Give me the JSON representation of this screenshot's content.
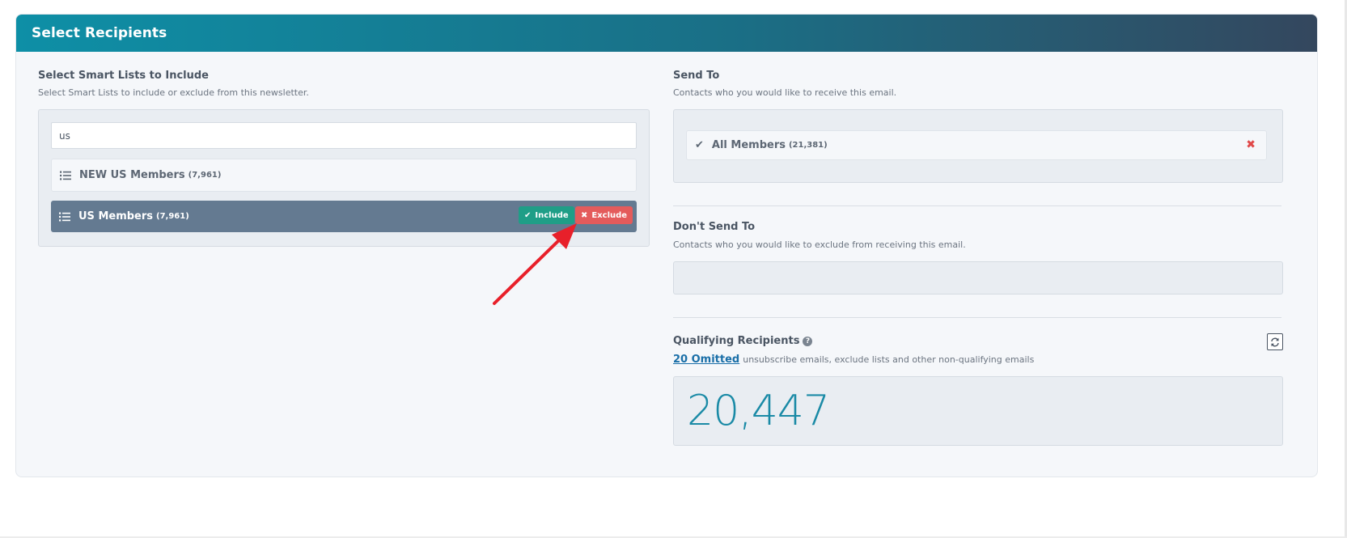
{
  "panel": {
    "title": "Select Recipients"
  },
  "include": {
    "title": "Select Smart Lists to Include",
    "subtitle": "Select Smart Lists to include or exclude from this newsletter.",
    "search_value": "us",
    "lists": [
      {
        "label": "NEW US Members",
        "count": "(7,961)"
      },
      {
        "label": "US Members",
        "count": "(7,961)"
      }
    ],
    "include_label": "Include",
    "exclude_label": "Exclude"
  },
  "send_to": {
    "title": "Send To",
    "subtitle": "Contacts who you would like to receive this email.",
    "items": [
      {
        "label": "All Members",
        "count": "(21,381)"
      }
    ]
  },
  "dont_send": {
    "title": "Don't Send To",
    "subtitle": "Contacts who you would like to exclude from receiving this email."
  },
  "qualifying": {
    "title": "Qualifying Recipients",
    "omitted_link": "20 Omitted",
    "omitted_text": "unsubscribe emails, exclude lists and other non-qualifying emails",
    "count": "20,447"
  },
  "colors": {
    "header_start": "#0e8fa6",
    "header_end": "#34475e",
    "include": "#1f9e87",
    "exclude": "#e45b5b",
    "active_row": "#647a91",
    "count": "#1a8aa6",
    "annotation_arrow": "#e8202a"
  },
  "icons": [
    "list-icon",
    "check-icon",
    "times-icon",
    "question-circle-icon",
    "refresh-icon"
  ]
}
